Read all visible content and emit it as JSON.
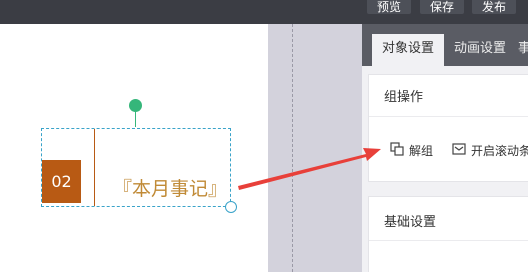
{
  "topbar": {
    "buttons": [
      {
        "label": "预览"
      },
      {
        "label": "保存"
      },
      {
        "label": "发布"
      }
    ]
  },
  "canvas": {
    "component": {
      "number": "02",
      "title": "『本月事记』"
    }
  },
  "panel": {
    "tabs": [
      {
        "label": "对象设置",
        "active": true
      },
      {
        "label": "动画设置",
        "active": false
      },
      {
        "label": "事",
        "active": false
      }
    ],
    "group_ops": {
      "title": "组操作",
      "ungroup_label": "解组",
      "scroll_label": "开启滚动条"
    },
    "basic": {
      "title": "基础设置"
    }
  },
  "colors": {
    "accent_orange": "#b85a14",
    "title_gold": "#c08a36",
    "selection_blue": "#3aa3c9",
    "handle_green": "#35b67a",
    "arrow_red": "#e8403a"
  }
}
